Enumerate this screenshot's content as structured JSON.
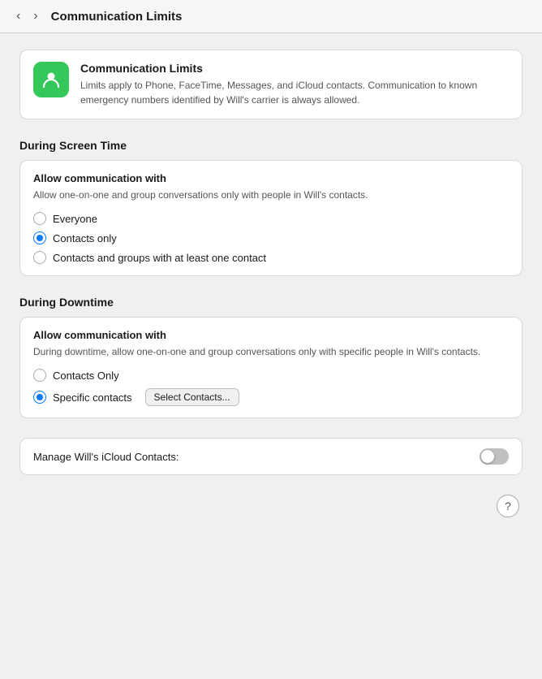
{
  "titlebar": {
    "title": "Communication Limits",
    "back_btn_label": "‹",
    "forward_btn_label": "›"
  },
  "info_card": {
    "title": "Communication Limits",
    "description": "Limits apply to Phone, FaceTime, Messages, and iCloud contacts. Communication to known emergency numbers identified by Will's carrier is always allowed.",
    "icon_label": "communication-limits-icon"
  },
  "screen_time_section": {
    "header": "During Screen Time",
    "panel_title": "Allow communication with",
    "panel_desc": "Allow one-on-one and group conversations only with people in Will's contacts.",
    "options": [
      {
        "label": "Everyone",
        "selected": false
      },
      {
        "label": "Contacts only",
        "selected": true
      },
      {
        "label": "Contacts and groups with at least one contact",
        "selected": false
      }
    ]
  },
  "downtime_section": {
    "header": "During Downtime",
    "panel_title": "Allow communication with",
    "panel_desc": "During downtime, allow one-on-one and group conversations only with specific people in Will's contacts.",
    "options": [
      {
        "label": "Contacts Only",
        "selected": false
      },
      {
        "label": "Specific contacts",
        "selected": true
      }
    ],
    "select_button_label": "Select Contacts..."
  },
  "manage_row": {
    "label": "Manage Will's iCloud Contacts:",
    "toggle_on": false
  },
  "help": {
    "label": "?"
  }
}
